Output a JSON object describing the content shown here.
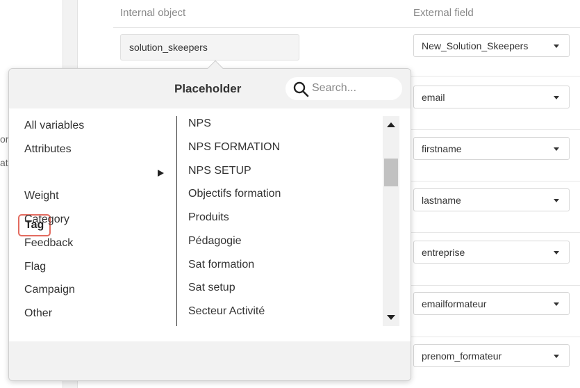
{
  "table": {
    "internal_header": "Internal object",
    "external_header": "External field",
    "internal_value": "solution_skeepers",
    "left_cut_1": "or",
    "left_cut_2": "ati",
    "external_fields": [
      "New_Solution_Skeepers",
      "email",
      "firstname",
      "lastname",
      "entreprise",
      "emailformateur",
      "prenom_formateur"
    ]
  },
  "popover": {
    "title": "Placeholder",
    "search_placeholder": "Search...",
    "categories": [
      "All variables",
      "Attributes",
      "Tag",
      "Weight",
      "Category",
      "Feedback",
      "Flag",
      "Campaign",
      "Other"
    ],
    "selected_category": "Tag",
    "tags": [
      "NPS",
      "NPS FORMATION",
      "NPS SETUP",
      "Objectifs formation",
      "Produits",
      "Pédagogie",
      "Sat formation",
      "Sat setup",
      "Secteur Activité"
    ]
  },
  "colors": {
    "selected_outline": "#e36b5f",
    "panel_gray": "#f2f2f2"
  },
  "icons": [
    "search-icon",
    "chevron-right-icon",
    "scroll-up-icon",
    "scroll-down-icon",
    "dropdown-caret-icon"
  ]
}
